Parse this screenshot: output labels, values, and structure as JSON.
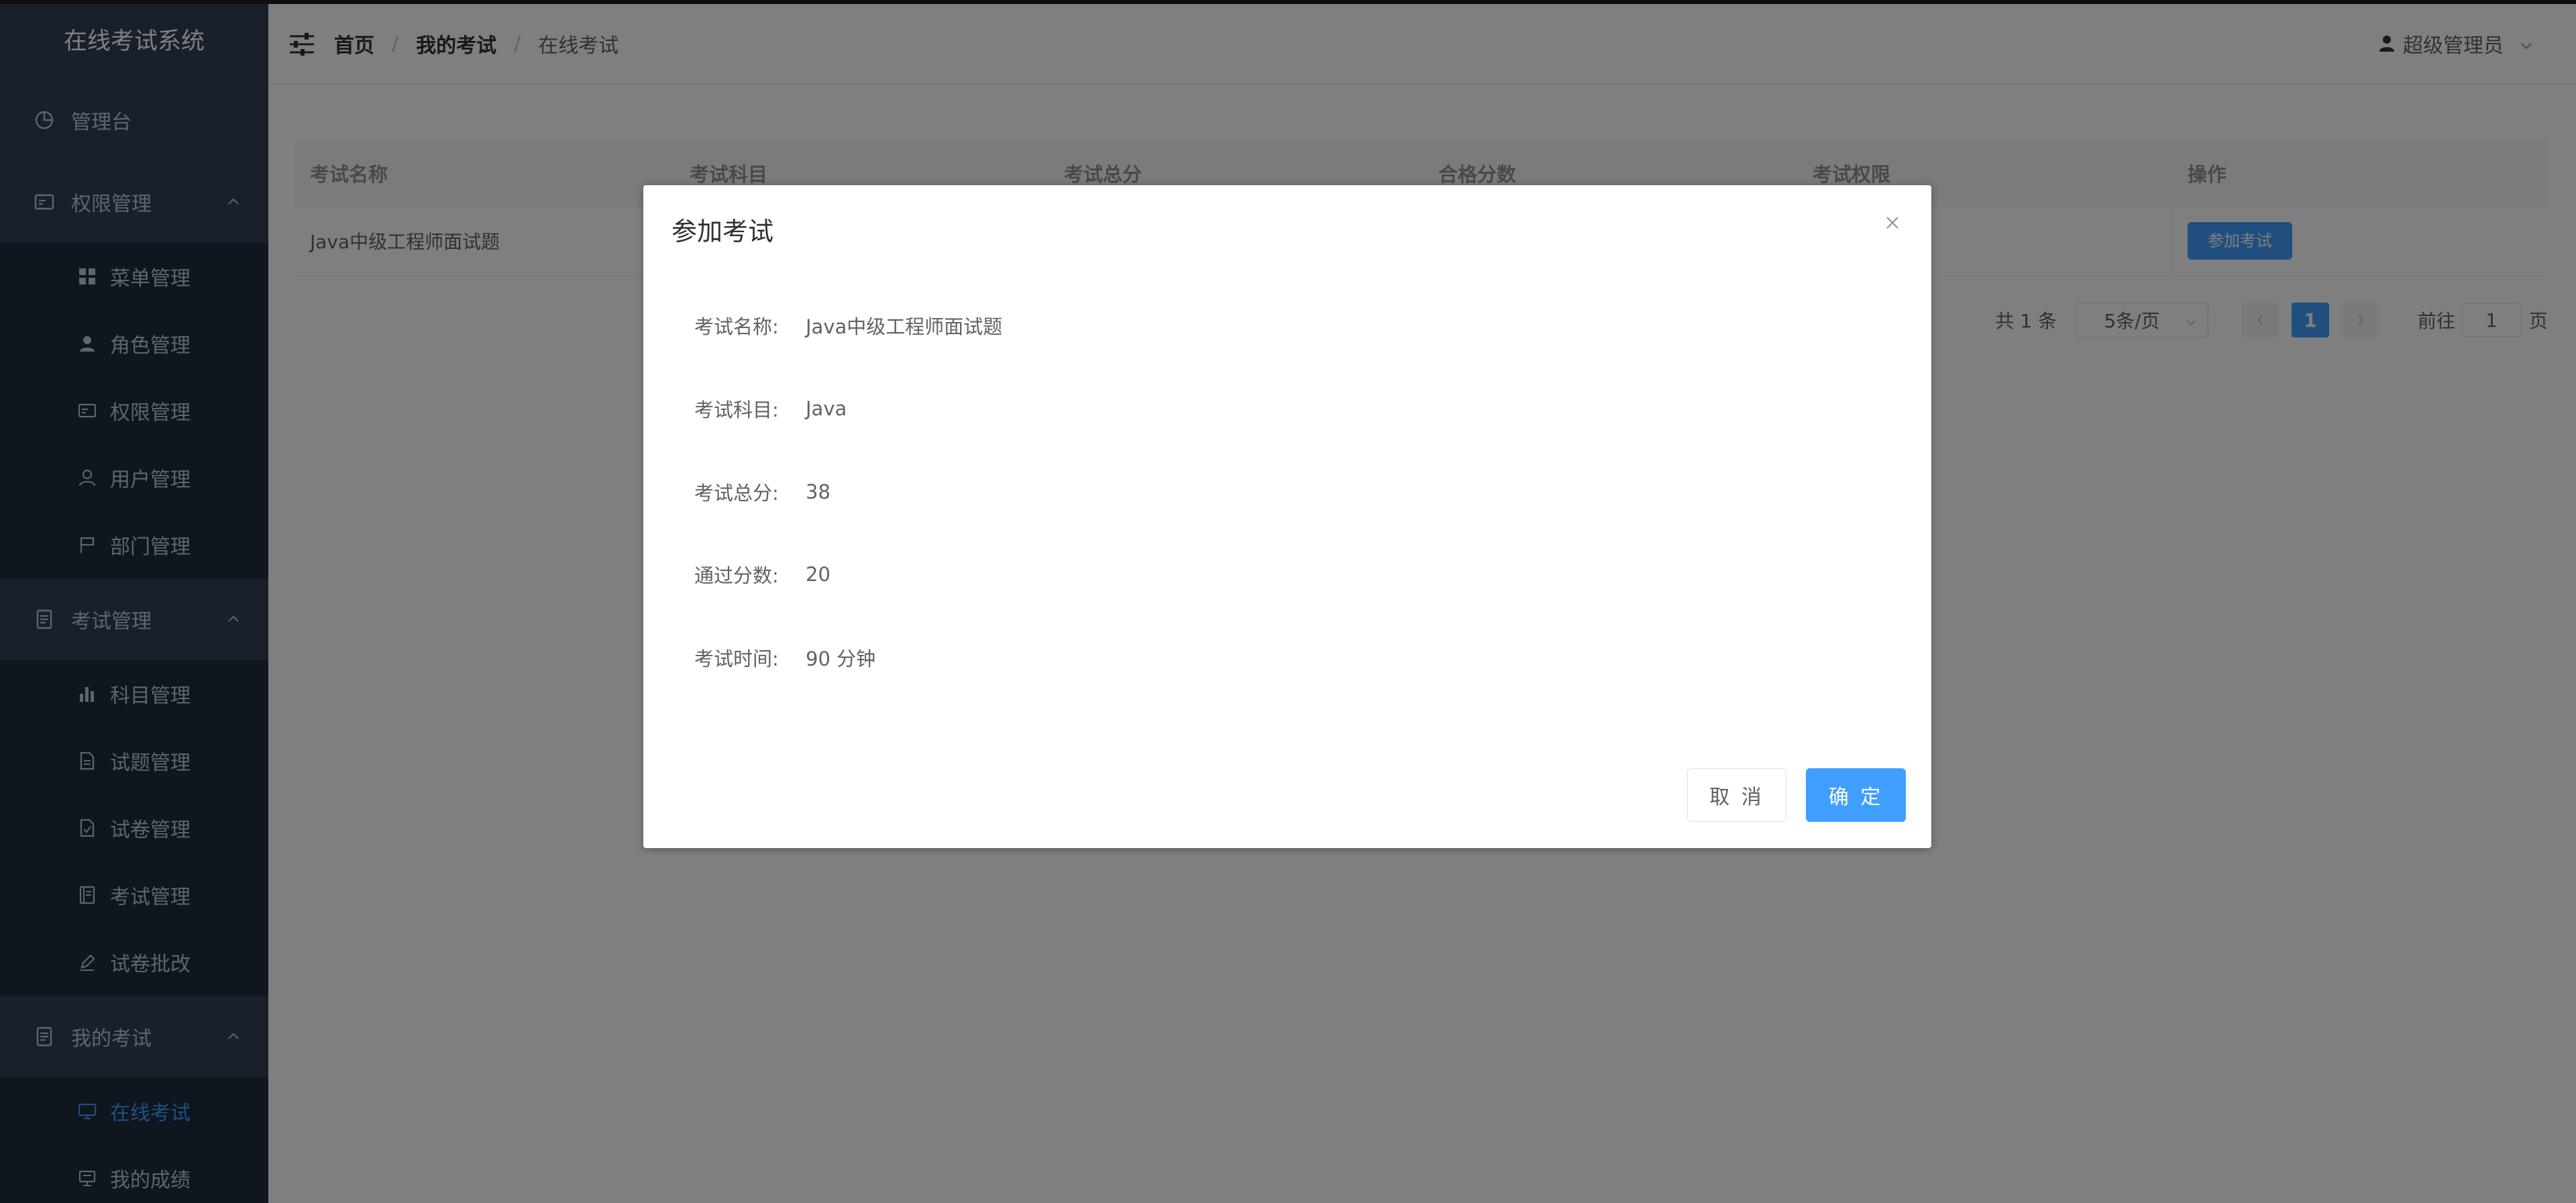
{
  "app": {
    "title": "在线考试系统"
  },
  "sidebar": {
    "items": [
      {
        "label": "管理台",
        "icon": "dashboard-icon"
      },
      {
        "label": "权限管理",
        "icon": "permission-icon",
        "children": [
          {
            "label": "菜单管理",
            "icon": "grid-icon"
          },
          {
            "label": "角色管理",
            "icon": "user-solid-icon"
          },
          {
            "label": "权限管理",
            "icon": "id-card-icon"
          },
          {
            "label": "用户管理",
            "icon": "user-icon"
          },
          {
            "label": "部门管理",
            "icon": "flag-icon"
          }
        ]
      },
      {
        "label": "考试管理",
        "icon": "document-icon",
        "children": [
          {
            "label": "科目管理",
            "icon": "bar-chart-icon"
          },
          {
            "label": "试题管理",
            "icon": "file-icon"
          },
          {
            "label": "试卷管理",
            "icon": "file-check-icon"
          },
          {
            "label": "考试管理",
            "icon": "notebook-icon"
          },
          {
            "label": "试卷批改",
            "icon": "pen-icon"
          }
        ]
      },
      {
        "label": "我的考试",
        "icon": "document-icon",
        "children": [
          {
            "label": "在线考试",
            "icon": "monitor-icon"
          },
          {
            "label": "我的成绩",
            "icon": "trophy-icon"
          }
        ]
      }
    ],
    "active_item": "在线考试",
    "active_color": "#409eff"
  },
  "header": {
    "breadcrumb": [
      "首页",
      "我的考试",
      "在线考试"
    ],
    "user_name": "超级管理员"
  },
  "table": {
    "headers": [
      "考试名称",
      "考试科目",
      "考试总分",
      "合格分数",
      "考试权限",
      "操作"
    ],
    "rows": [
      {
        "name": "Java中级工程师面试题",
        "action": "参加考试"
      }
    ]
  },
  "pagination": {
    "total": "共 1 条",
    "page_size": "5条/页",
    "current_page": "1",
    "goto_label": "前往",
    "goto_value": "1",
    "page_suffix": "页"
  },
  "dialog": {
    "title": "参加考试",
    "fields": [
      {
        "label": "考试名称:",
        "value": "Java中级工程师面试题"
      },
      {
        "label": "考试科目:",
        "value": "Java"
      },
      {
        "label": "考试总分:",
        "value": "38"
      },
      {
        "label": "通过分数:",
        "value": "20"
      },
      {
        "label": "考试时间:",
        "value": "90 分钟"
      }
    ],
    "cancel_label": "取 消",
    "ok_label": "确 定"
  },
  "colors": {
    "sidebar_bg": "#304156",
    "submenu_bg": "#1f2d3d",
    "primary": "#409eff"
  }
}
